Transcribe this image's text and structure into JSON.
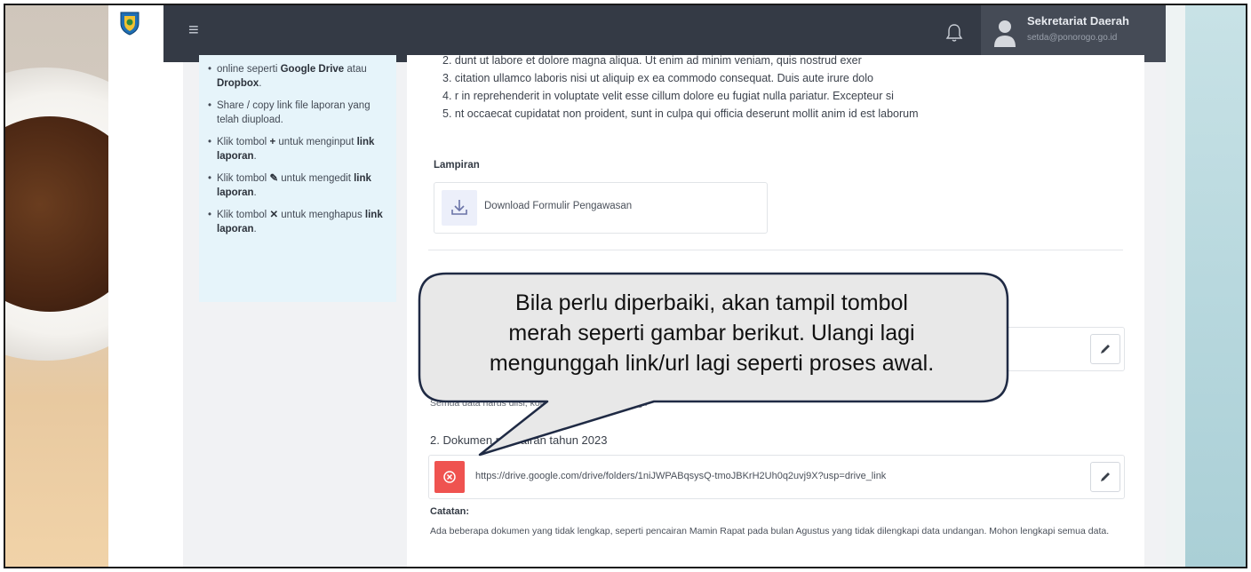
{
  "header": {
    "user_name": "Sekretariat Daerah",
    "user_email": "setda@ponorogo.go.id",
    "menu_icon": "hamburger-icon",
    "notification_icon": "bell-icon"
  },
  "help": {
    "item0_line": "online seperti ",
    "item0_bold1": "Google Drive",
    "item0_mid": " atau ",
    "item0_bold2": "Dropbox",
    "item0_end": ".",
    "item1": "Share / copy link file laporan yang telah diupload.",
    "item2_pre": "Klik tombol ",
    "item2_icon": "+",
    "item2_mid": " untuk menginput ",
    "item2_bold": "link laporan",
    "item2_end": ".",
    "item3_pre": "Klik tombol ",
    "item3_icon": "✎",
    "item3_mid": " untuk mengedit ",
    "item3_bold": "link laporan",
    "item3_end": ".",
    "item4_pre": "Klik tombol ",
    "item4_icon": "✕",
    "item4_mid": " untuk menghapus ",
    "item4_bold": "link laporan",
    "item4_end": "."
  },
  "instructions": [
    "2. dunt ut labore et dolore magna aliqua. Ut enim ad minim veniam, quis nostrud exer",
    "3. citation ullamco laboris nisi ut aliquip ex ea commodo consequat. Duis aute irure dolo",
    "4. r in reprehenderit in voluptate velit esse cillum dolore eu fugiat nulla pariatur. Excepteur si",
    "5. nt occaecat cupidatat non proident, sunt in culpa qui officia deserunt mollit anim id est laborum"
  ],
  "attachments": {
    "label": "Lampiran",
    "download_label": "Download Formulir Pengawasan"
  },
  "hint_text": "Semua data harus diisi, kolom tidak boleh dikosongi.",
  "document": {
    "title": "2. Dokumen pencairan tahun 2023",
    "link": "https://drive.google.com/drive/folders/1niJWPABqsysQ-tmoJBKrH2Uh0q2uvj9X?usp=drive_link"
  },
  "note": {
    "label": "Catatan:",
    "text": "Ada beberapa dokumen yang tidak lengkap, seperti pencairan Mamin Rapat pada bulan Agustus yang tidak dilengkapi data undangan. Mohon lengkapi semua data."
  },
  "callout": {
    "line1": "Bila perlu diperbaiki, akan tampil tombol",
    "line2": "merah seperti gambar berikut. Ulangi lagi",
    "line3": "mengunggah link/url lagi seperti proses awal."
  },
  "colors": {
    "topbar": "#343a45",
    "error_button": "#ef5350",
    "help_card": "#e6f4fa"
  }
}
